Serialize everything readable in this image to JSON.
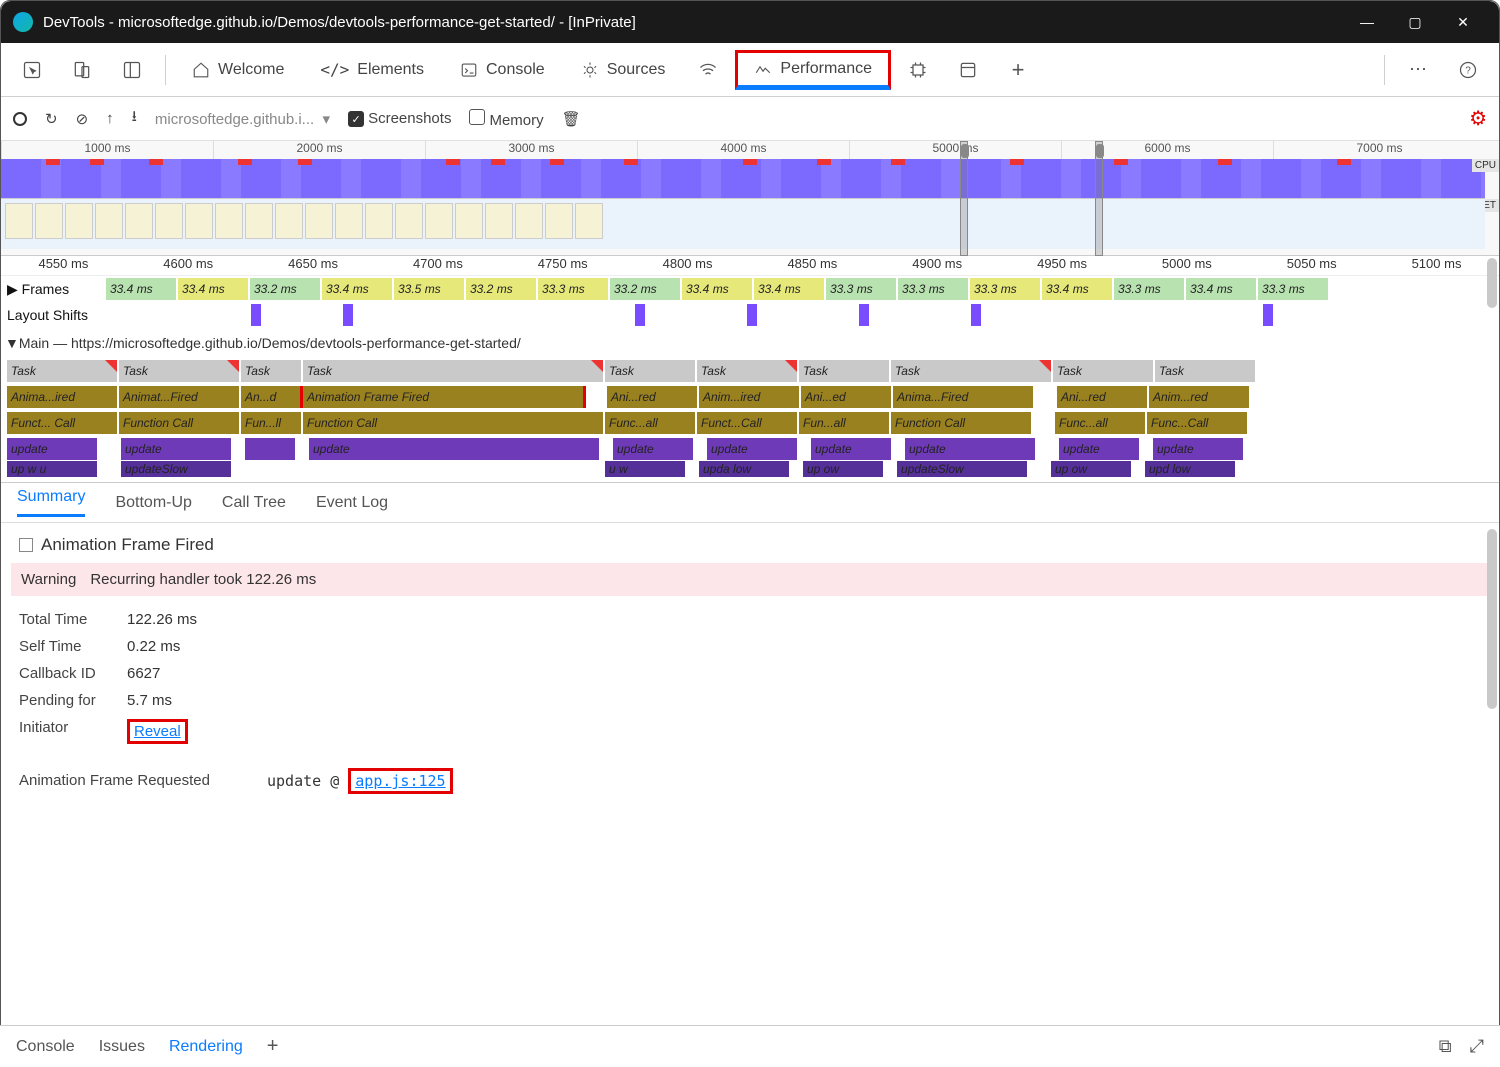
{
  "window": {
    "title": "DevTools - microsoftedge.github.io/Demos/devtools-performance-get-started/ - [InPrivate]"
  },
  "panel_tabs": {
    "welcome": "Welcome",
    "elements": "Elements",
    "console": "Console",
    "sources": "Sources",
    "performance": "Performance"
  },
  "toolbar": {
    "url_trunc": "microsoftedge.github.i...",
    "screenshots_label": "Screenshots",
    "memory_label": "Memory"
  },
  "overview": {
    "ticks": [
      "1000 ms",
      "2000 ms",
      "3000 ms",
      "4000 ms",
      "5000 ms",
      "6000 ms",
      "7000 ms"
    ],
    "cpu_label": "CPU",
    "net_label": "NET"
  },
  "jump_ticks": [
    "4550 ms",
    "4600 ms",
    "4650 ms",
    "4700 ms",
    "4750 ms",
    "4800 ms",
    "4850 ms",
    "4900 ms",
    "4950 ms",
    "5000 ms",
    "5050 ms",
    "5100 ms"
  ],
  "tracks": {
    "frames_label": "Frames",
    "layout_label": "Layout Shifts",
    "main_label": "Main — https://microsoftedge.github.io/Demos/devtools-performance-get-started/",
    "frame_times": [
      "33.4 ms",
      "33.4 ms",
      "33.2 ms",
      "33.4 ms",
      "33.5 ms",
      "33.2 ms",
      "33.3 ms",
      "33.2 ms",
      "33.4 ms",
      "33.4 ms",
      "33.3 ms",
      "33.3 ms",
      "33.3 ms",
      "33.4 ms",
      "33.3 ms",
      "33.4 ms",
      "33.3 ms"
    ],
    "task": "Task",
    "af_long": "Animation Frame Fired",
    "af_a": "Anima...ired",
    "af_b": "Animat...Fired",
    "af_c": "An...d",
    "af_d": "Ani...red",
    "af_e": "Anim...ired",
    "af_f": "Ani...ed",
    "af_g": "Anima...Fired",
    "af_h": "Anim...red",
    "fc_long": "Function Call",
    "fc_a": "Funct... Call",
    "fc_b": "Fun...ll",
    "fc_c": "Func...all",
    "fc_d": "Funct...Call",
    "fc_e": "Fun...all",
    "fc_f": "Func...all",
    "fc_g": "Func...Call",
    "upd": "update",
    "us_a": "up  w   u",
    "us_b": "updateSlow",
    "us_c": "u  w",
    "us_d": "upda  low",
    "us_e": "up  ow",
    "us_f": "updateSlow",
    "us_g": "up  ow",
    "us_h": "upd  low"
  },
  "detail_tabs": {
    "summary": "Summary",
    "bottomup": "Bottom-Up",
    "calltree": "Call Tree",
    "eventlog": "Event Log"
  },
  "summary": {
    "event_title": "Animation Frame Fired",
    "warn_k": "Warning",
    "warn_v": "Recurring handler took 122.26 ms",
    "total_k": "Total Time",
    "total_v": "122.26 ms",
    "self_k": "Self Time",
    "self_v": "0.22 ms",
    "cb_k": "Callback ID",
    "cb_v": "6627",
    "pending_k": "Pending for",
    "pending_v": "5.7 ms",
    "init_k": "Initiator",
    "init_v": "Reveal",
    "afr_k": "Animation Frame Requested",
    "stack_fn": "update @",
    "stack_loc": "app.js:125"
  },
  "drawer": {
    "console": "Console",
    "issues": "Issues",
    "rendering": "Rendering"
  }
}
